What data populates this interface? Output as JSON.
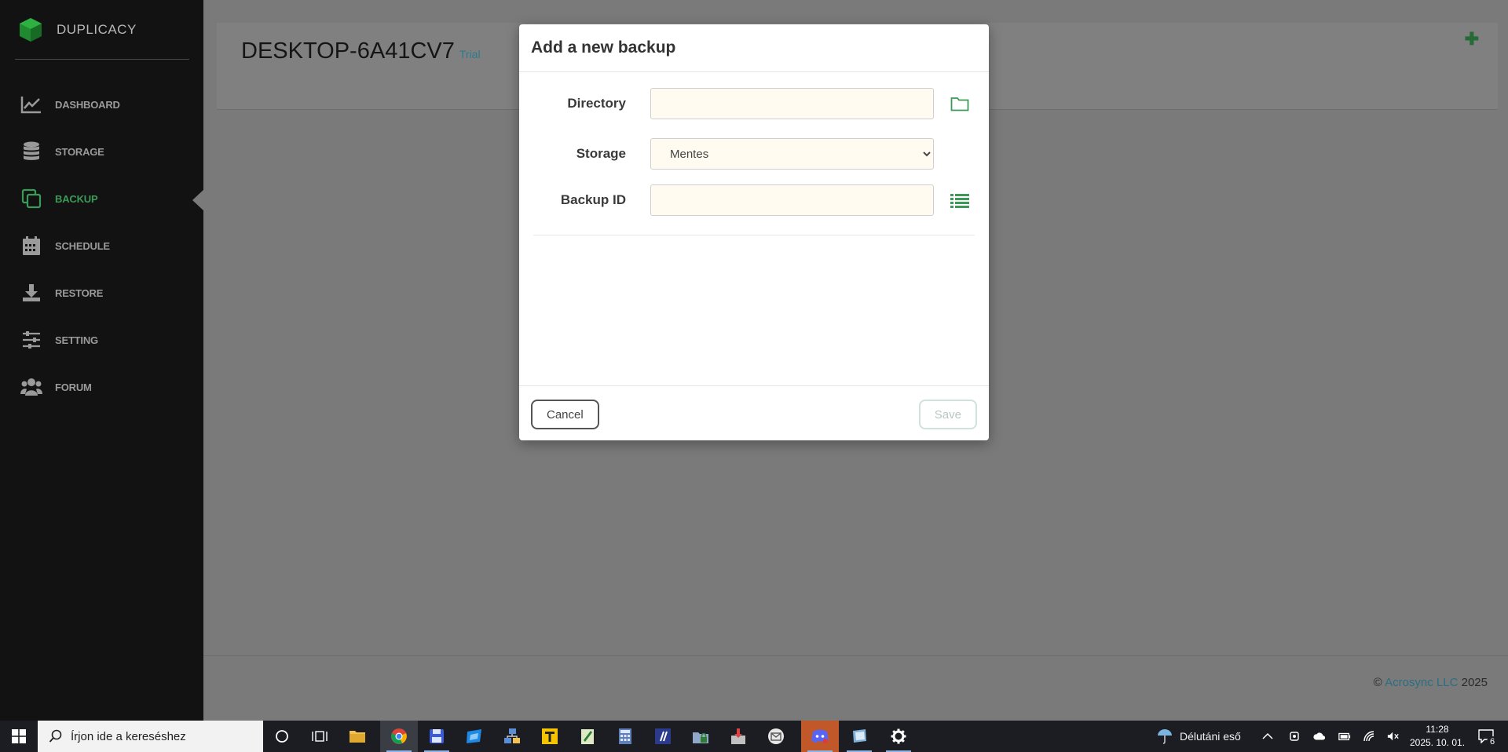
{
  "app": {
    "brand": "DUPLICACY",
    "host": "DESKTOP-6A41CV7",
    "license": "Trial"
  },
  "sidebar": {
    "items": [
      {
        "label": "DASHBOARD",
        "icon": "chart-line-icon",
        "active": false
      },
      {
        "label": "STORAGE",
        "icon": "database-icon",
        "active": false
      },
      {
        "label": "BACKUP",
        "icon": "copy-icon",
        "active": true
      },
      {
        "label": "SCHEDULE",
        "icon": "calendar-icon",
        "active": false
      },
      {
        "label": "RESTORE",
        "icon": "download-icon",
        "active": false
      },
      {
        "label": "SETTING",
        "icon": "sliders-icon",
        "active": false
      },
      {
        "label": "FORUM",
        "icon": "users-icon",
        "active": false
      }
    ]
  },
  "modal": {
    "title": "Add a new backup",
    "directory_label": "Directory",
    "directory_value": "",
    "storage_label": "Storage",
    "storage_selected": "Mentes",
    "backup_id_label": "Backup ID",
    "backup_id_value": "",
    "cancel_label": "Cancel",
    "save_label": "Save"
  },
  "footer": {
    "copyright_symbol": "©",
    "company": "Acrosync LLC",
    "year": "2025"
  },
  "taskbar": {
    "search_placeholder": "Írjon ide a kereséshez",
    "weather": "Délutáni eső",
    "time": "11:28",
    "date": "2025. 10. 01.",
    "notification_count": "6"
  },
  "colors": {
    "accent_green": "#3b9a57",
    "link_teal": "#2f7a8c",
    "sidebar_bg": "#121212",
    "overlay_bg": "#7a7a7a"
  }
}
